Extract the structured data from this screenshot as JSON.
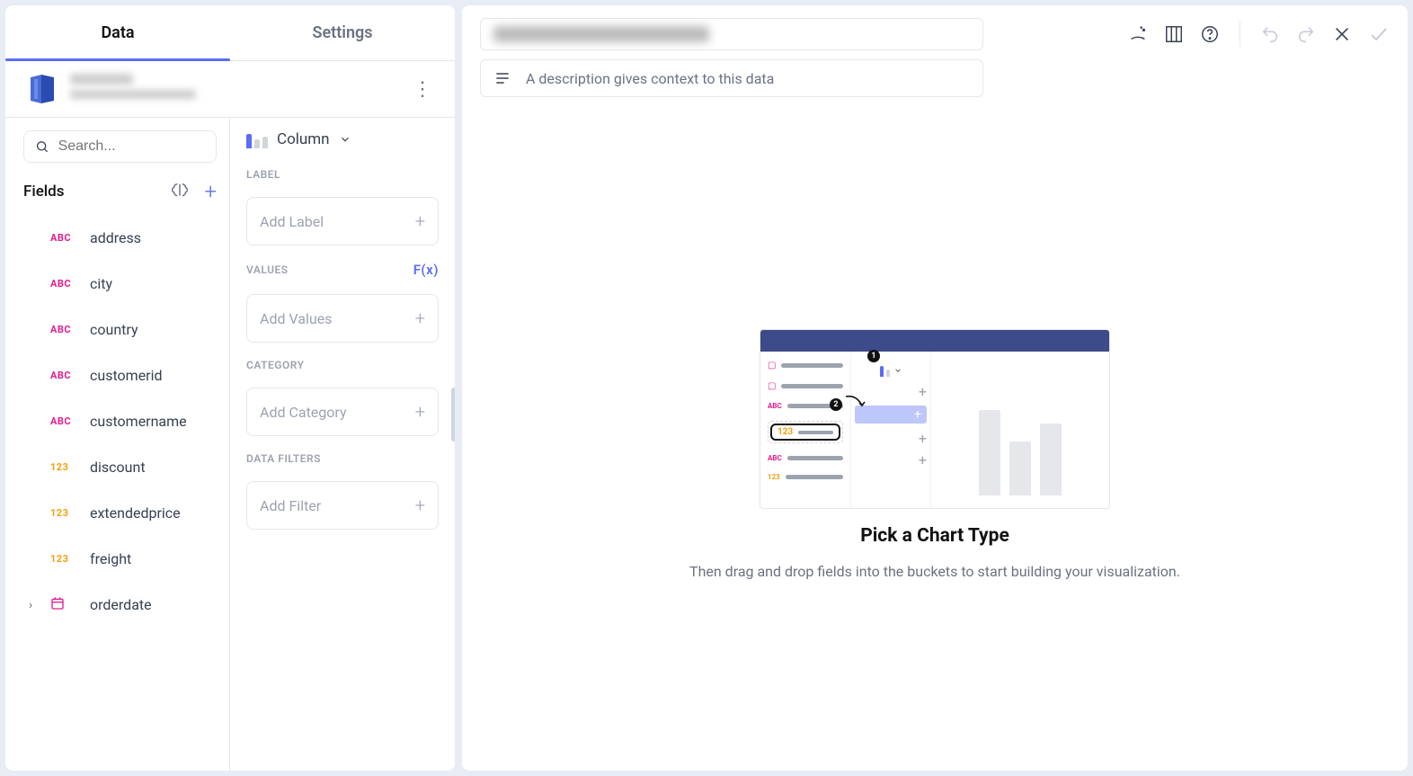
{
  "tabs": {
    "data": "Data",
    "settings": "Settings"
  },
  "search_placeholder": "Search...",
  "fields_heading": "Fields",
  "fields": [
    {
      "type": "ABC",
      "name": "address"
    },
    {
      "type": "ABC",
      "name": "city"
    },
    {
      "type": "ABC",
      "name": "country"
    },
    {
      "type": "ABC",
      "name": "customerid"
    },
    {
      "type": "ABC",
      "name": "customername"
    },
    {
      "type": "123",
      "name": "discount"
    },
    {
      "type": "123",
      "name": "extendedprice"
    },
    {
      "type": "123",
      "name": "freight"
    },
    {
      "type": "DATE",
      "name": "orderdate"
    }
  ],
  "chart_type": "Column",
  "buckets": {
    "label_section": "LABEL",
    "values_section": "VALUES",
    "category_section": "CATEGORY",
    "filters_section": "DATA FILTERS",
    "fx_label": "F(x)",
    "add_label": "Add Label",
    "add_values": "Add Values",
    "add_category": "Add Category",
    "add_filter": "Add Filter"
  },
  "description_placeholder": "A description gives context to this data",
  "empty_state": {
    "title": "Pick a Chart Type",
    "subtitle": "Then drag and drop fields into the buckets to start building your visualization."
  }
}
